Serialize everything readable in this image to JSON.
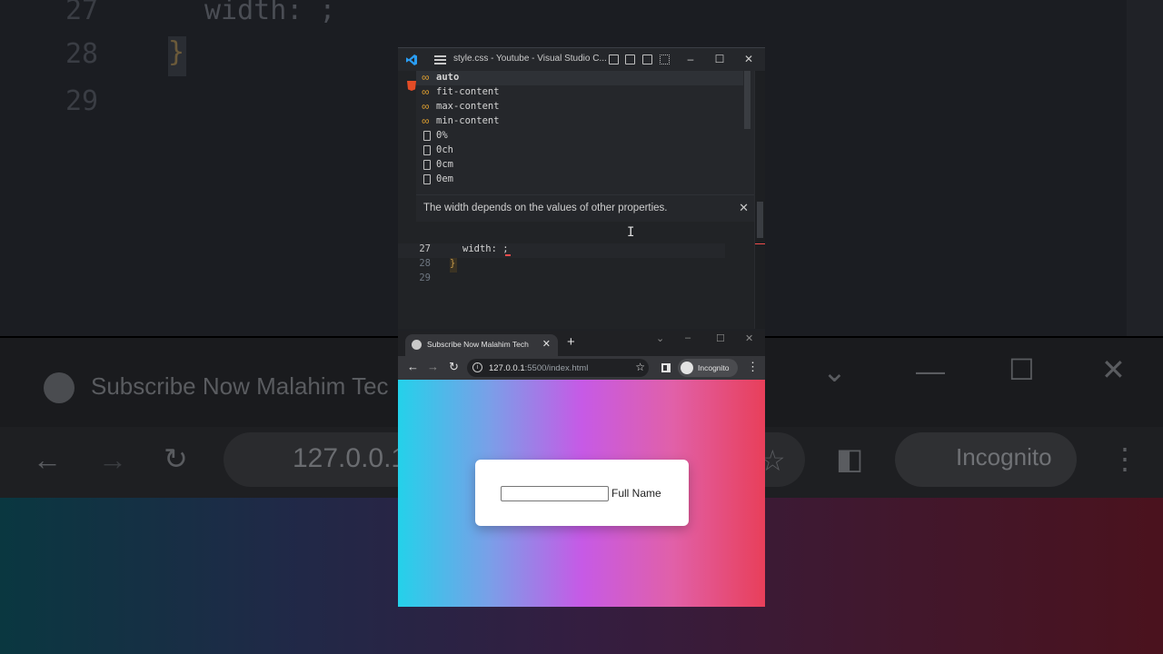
{
  "background": {
    "line_numbers": [
      "27",
      "28",
      "29"
    ],
    "code_text": "width: ;",
    "brace": "}",
    "tab_title": "Subscribe Now Malahim Tec",
    "url": "127.0.0.1",
    "incognito": "Incognito"
  },
  "vscode": {
    "title": "style.css - Youtube - Visual Studio C...",
    "suggestions": [
      {
        "label": "auto",
        "icon": "value-enum-icon",
        "selected": true
      },
      {
        "label": "fit-content",
        "icon": "value-enum-icon"
      },
      {
        "label": "max-content",
        "icon": "value-enum-icon"
      },
      {
        "label": "min-content",
        "icon": "value-enum-icon"
      },
      {
        "label": "0%",
        "icon": "unit-icon"
      },
      {
        "label": "0ch",
        "icon": "unit-icon"
      },
      {
        "label": "0cm",
        "icon": "unit-icon"
      },
      {
        "label": "0em",
        "icon": "unit-icon"
      }
    ],
    "hover_doc": "The width depends on the values of other properties.",
    "code": [
      {
        "num": "27",
        "text": "width: ;"
      },
      {
        "num": "28",
        "text": "}"
      },
      {
        "num": "29",
        "text": ""
      }
    ]
  },
  "chrome": {
    "tab_title": "Subscribe Now Malahim Tech",
    "url_host": "127.0.0.1",
    "url_rest": ":5500/index.html",
    "incognito_label": "Incognito"
  },
  "page": {
    "input_value": "",
    "input_label": "Full Name"
  },
  "colors": {
    "gradient": [
      "#24d1ea",
      "#c65ae6",
      "#e83f5a"
    ],
    "vscode_bg": "#212326",
    "accent_orange": "#e0a030"
  }
}
